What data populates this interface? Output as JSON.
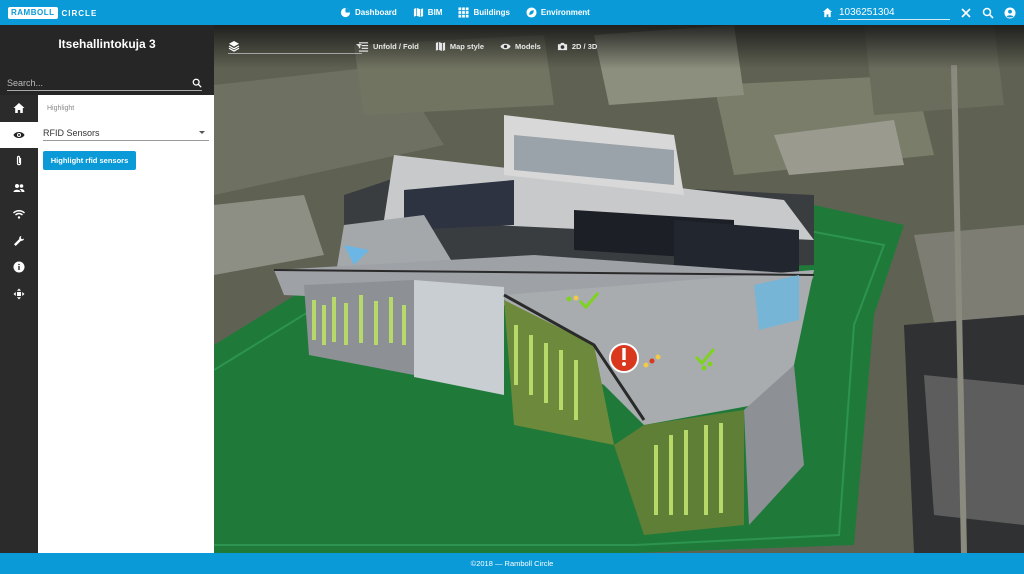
{
  "app": {
    "logo_box": "RAMBOLL",
    "logo_text": "CIRCLE"
  },
  "nav": [
    {
      "label": "Dashboard",
      "icon": "pie-chart-icon"
    },
    {
      "label": "BIM",
      "icon": "map-icon"
    },
    {
      "label": "Buildings",
      "icon": "grid-icon"
    },
    {
      "label": "Environment",
      "icon": "leaf-icon"
    }
  ],
  "top_search": {
    "value": "1036251304"
  },
  "sidebar": {
    "title": "Itsehallintokuja 3",
    "search_placeholder": "Search...",
    "rail": [
      {
        "icon": "home-icon",
        "active": false
      },
      {
        "icon": "eye-icon",
        "active": true
      },
      {
        "icon": "paperclip-icon",
        "active": false
      },
      {
        "icon": "people-icon",
        "active": false
      },
      {
        "icon": "wifi-icon",
        "active": false
      },
      {
        "icon": "wrench-icon",
        "active": false
      },
      {
        "icon": "info-icon",
        "active": false
      },
      {
        "icon": "move-icon",
        "active": false
      }
    ],
    "panel": {
      "label": "Highlight",
      "select_value": "RFID Sensors",
      "button_label": "Highlight rfid sensors"
    }
  },
  "map_toolbar": {
    "items": [
      {
        "label": "Unfold / Fold",
        "icon": "list-indent-icon"
      },
      {
        "label": "Map style",
        "icon": "map-icon"
      },
      {
        "label": "Models",
        "icon": "eye-icon"
      },
      {
        "label": "2D / 3D",
        "icon": "camera-icon"
      }
    ]
  },
  "footer": {
    "text": "©2018 — Ramboll Circle"
  },
  "colors": {
    "accent": "#0a9ad8",
    "dark": "#262626",
    "ground": "#1f7a3a",
    "alert": "#d9381e",
    "ok": "#7ed321"
  }
}
